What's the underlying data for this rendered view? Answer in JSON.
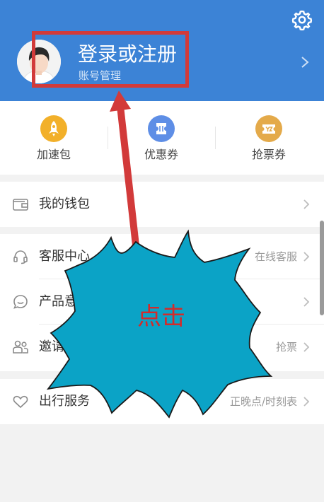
{
  "header": {
    "login_title": "登录或注册",
    "login_subtitle": "账号管理",
    "bg_color": "#3c83d6"
  },
  "quick_actions": [
    {
      "label": "加速包",
      "icon": "rocket-icon",
      "color": "#f2b02a"
    },
    {
      "label": "优惠券",
      "icon": "coupon-icon",
      "color": "#5e8ee6"
    },
    {
      "label": "抢票券",
      "icon": "ticket-icon",
      "color": "#e4aa4a"
    }
  ],
  "menu": {
    "wallet": {
      "label": "我的钱包"
    },
    "service": {
      "label": "客服中心",
      "right": "在线客服"
    },
    "feedback": {
      "label": "产品意"
    },
    "invite": {
      "label": "邀请好",
      "right": "抢票"
    },
    "travel": {
      "label": "出行服务",
      "right": "正晚点/时刻表"
    }
  },
  "annotation": {
    "text": "点击",
    "fill_color": "#0ba3c6",
    "arrow_color": "#d23a3a"
  }
}
